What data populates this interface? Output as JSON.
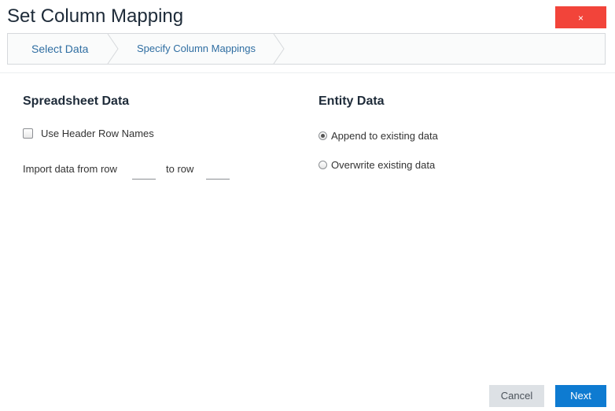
{
  "dialog": {
    "title": "Set Column Mapping",
    "close_label": "×"
  },
  "breadcrumb": {
    "steps": [
      {
        "label": "Select Data"
      },
      {
        "label": "Specify Column Mappings"
      }
    ]
  },
  "spreadsheet": {
    "heading": "Spreadsheet Data",
    "use_header_label": "Use Header Row Names",
    "use_header_checked": false,
    "import_from_label": "Import data from row",
    "to_row_label": "to row",
    "from_value": "",
    "to_value": ""
  },
  "entity": {
    "heading": "Entity Data",
    "options": [
      {
        "label": "Append to existing data",
        "checked": true
      },
      {
        "label": "Overwrite existing data",
        "checked": false
      }
    ]
  },
  "footer": {
    "cancel_label": "Cancel",
    "next_label": "Next"
  },
  "colors": {
    "close": "#f2443a",
    "primary": "#0e7bd1",
    "link": "#2f6ea2"
  }
}
